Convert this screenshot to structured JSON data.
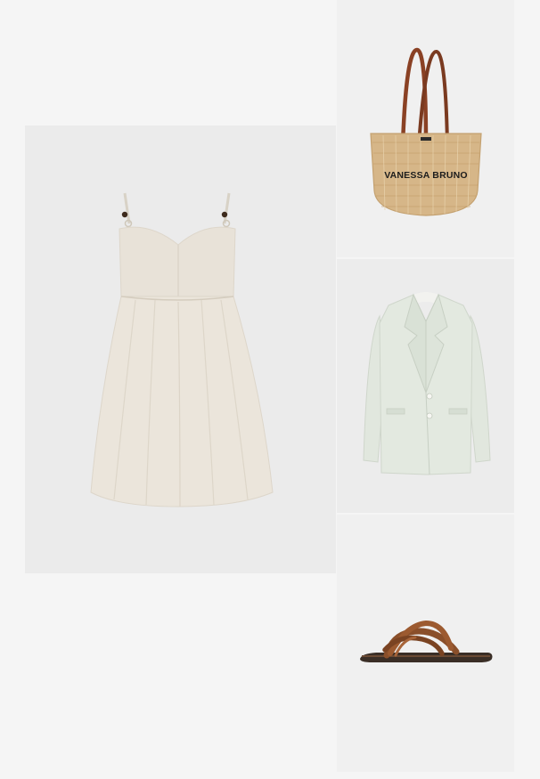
{
  "products": [
    {
      "id": "dress",
      "icon": "linen-sundress-image",
      "color": "#e6e0d6"
    },
    {
      "id": "bag",
      "icon": "straw-tote-bag-image",
      "brand_text": "VANESSA BRUNO",
      "color": "#d9b98a"
    },
    {
      "id": "blazer",
      "icon": "linen-blazer-image",
      "color": "#dfe6dc"
    },
    {
      "id": "sandal",
      "icon": "leather-sandal-image",
      "color": "#8a4f2a"
    }
  ]
}
